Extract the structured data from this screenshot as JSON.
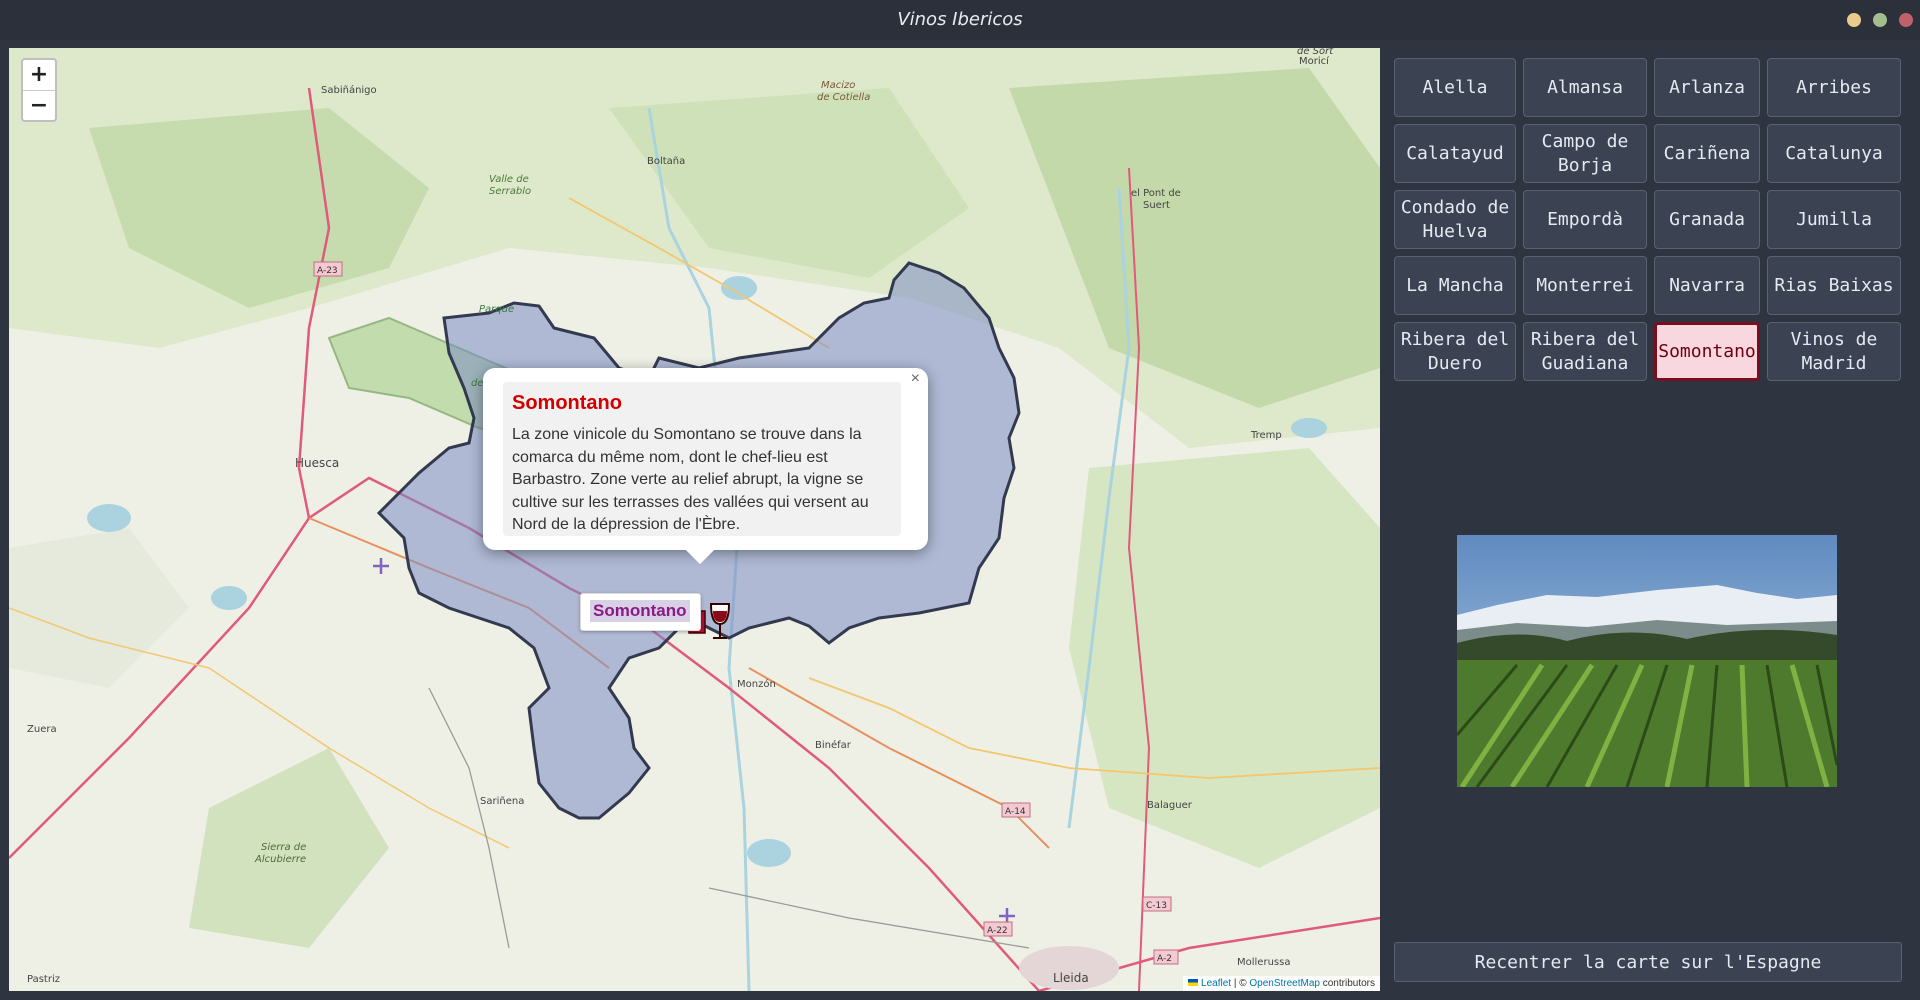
{
  "window": {
    "title": "Vinos Ibericos",
    "controls": [
      {
        "name": "minimize",
        "color": "#ebcb8b"
      },
      {
        "name": "maximize",
        "color": "#a3be8c"
      },
      {
        "name": "close",
        "color": "#bf616a"
      }
    ]
  },
  "map": {
    "zoom_in": "+",
    "zoom_out": "−",
    "places": [
      "Sabiñánigo",
      "Macizo de Cotiella",
      "Boltaña",
      "Valle de Serrablo",
      "Parque Natural de la Sierra y los Cañones de Guara",
      "El Pont de Suert",
      "Huesca",
      "Tremp",
      "Monzón",
      "Binéfar",
      "Zuera",
      "Sariñena",
      "Sierra de Alcubierre",
      "Balaguer",
      "Mollerussa",
      "Lleida",
      "Pastriz",
      "Sort",
      "Moricí"
    ],
    "roads": [
      "A-23",
      "A-14",
      "A-22",
      "C-13",
      "A-2"
    ],
    "popup": {
      "close": "×",
      "title": "Somontano",
      "text": "La zone vinicole du Somontano se trouve dans la comarca du même nom, dont le chef-lieu est Barbastro. Zone verte au relief abrupt, la vigne se cultive sur les terrasses des vallées qui versent au Nord de la dépression de l'Èbre."
    },
    "tooltip": "Somontano",
    "attribution": {
      "leaflet": "Leaflet",
      "separator": " | © ",
      "osm": "OpenStreetMap",
      "suffix": " contributors"
    },
    "region_color": "#7b8cc4"
  },
  "sidebar": {
    "regions": [
      {
        "label": "Alella",
        "active": false
      },
      {
        "label": "Almansa",
        "active": false
      },
      {
        "label": "Arlanza",
        "active": false
      },
      {
        "label": "Arribes",
        "active": false
      },
      {
        "label": "Calatayud",
        "active": false
      },
      {
        "label": "Campo de Borja",
        "active": false
      },
      {
        "label": "Cariñena",
        "active": false
      },
      {
        "label": "Catalunya",
        "active": false
      },
      {
        "label": "Condado de Huelva",
        "active": false
      },
      {
        "label": "Empordà",
        "active": false
      },
      {
        "label": "Granada",
        "active": false
      },
      {
        "label": "Jumilla",
        "active": false
      },
      {
        "label": "La Mancha",
        "active": false
      },
      {
        "label": "Monterrei",
        "active": false
      },
      {
        "label": "Navarra",
        "active": false
      },
      {
        "label": "Rias Baixas",
        "active": false
      },
      {
        "label": "Ribera del Duero",
        "active": false
      },
      {
        "label": "Ribera del Guadiana",
        "active": false
      },
      {
        "label": "Somontano",
        "active": true
      },
      {
        "label": "Vinos de Madrid",
        "active": false
      }
    ],
    "recenter_label": "Recentrer la carte sur l'Espagne"
  }
}
